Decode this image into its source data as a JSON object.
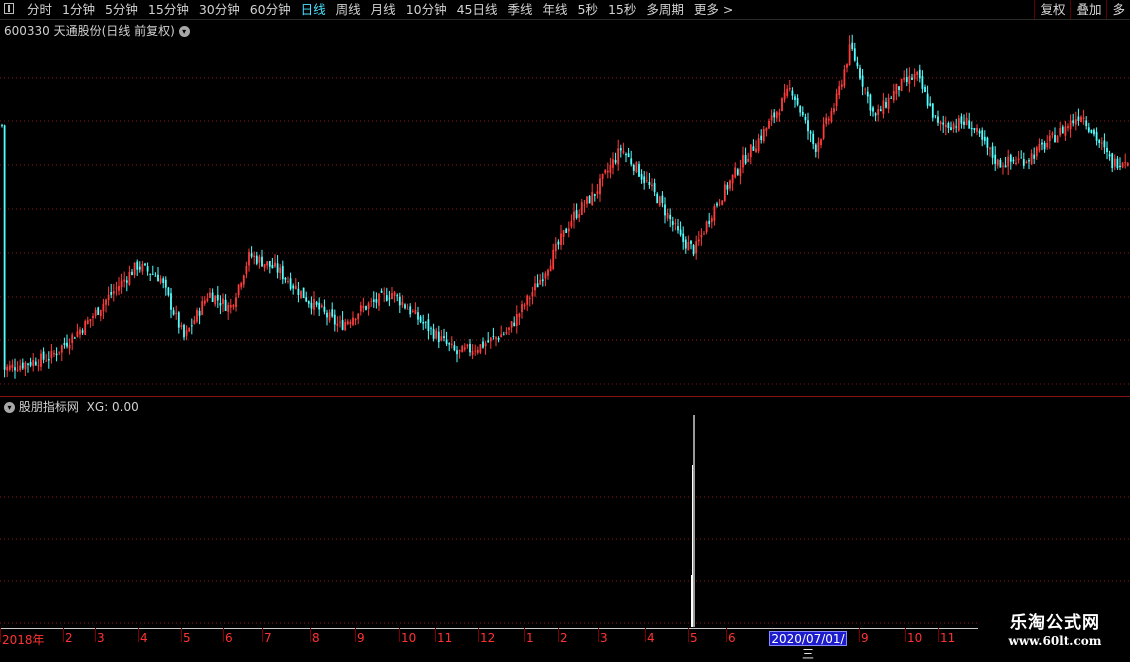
{
  "toolbar": {
    "periods": [
      "分时",
      "1分钟",
      "5分钟",
      "15分钟",
      "30分钟",
      "60分钟",
      "日线",
      "周线",
      "月线",
      "10分钟",
      "45日线",
      "季线",
      "年线",
      "5秒",
      "15秒",
      "多周期",
      "更多 >"
    ],
    "active_period": "日线",
    "right_buttons": [
      "复权",
      "叠加",
      "多"
    ]
  },
  "main_panel": {
    "title": "600330 天通股份(日线 前复权)"
  },
  "indicator_panel": {
    "title": "股朋指标网",
    "value_label": "XG: 0.00"
  },
  "x_axis": {
    "labels": [
      "2018年",
      "2",
      "3",
      "4",
      "5",
      "6",
      "7",
      "8",
      "9",
      "10",
      "11",
      "12",
      "1",
      "2",
      "3",
      "4",
      "5",
      "6",
      "9",
      "10",
      "11"
    ],
    "cursor_date": "2020/07/01/三"
  },
  "watermark": {
    "line1": "乐淘公式网",
    "line2": "www.60lt.com"
  },
  "colors": {
    "up": "#ff3c3c",
    "down": "#54ffff",
    "grid": "#8a1414",
    "signal": "#ffffff",
    "active_period": "#48e1ff",
    "axis_label": "#ff3232"
  },
  "chart_data": [
    {
      "type": "candlestick",
      "title": "600330 天通股份(日线 前复权)",
      "x_range": [
        "2018-01",
        "2020-11"
      ],
      "price_path": [
        [
          "2018-01-02",
          100
        ],
        [
          "2018-01-25",
          108
        ],
        [
          "2018-02-20",
          130
        ],
        [
          "2018-03-10",
          148
        ],
        [
          "2018-03-30",
          168
        ],
        [
          "2018-04-15",
          160
        ],
        [
          "2018-05-02",
          120
        ],
        [
          "2018-05-20",
          150
        ],
        [
          "2018-06-05",
          140
        ],
        [
          "2018-06-20",
          175
        ],
        [
          "2018-07-10",
          165
        ],
        [
          "2018-07-30",
          145
        ],
        [
          "2018-08-20",
          128
        ],
        [
          "2018-09-05",
          140
        ],
        [
          "2018-09-25",
          150
        ],
        [
          "2018-10-20",
          130
        ],
        [
          "2018-11-15",
          110
        ],
        [
          "2018-12-01",
          115
        ],
        [
          "2018-12-20",
          125
        ],
        [
          "2019-01-15",
          160
        ],
        [
          "2019-02-10",
          200
        ],
        [
          "2019-02-25",
          215
        ],
        [
          "2019-03-15",
          245
        ],
        [
          "2019-03-25",
          232
        ],
        [
          "2019-04-10",
          210
        ],
        [
          "2019-04-25",
          185
        ],
        [
          "2019-05-05",
          178
        ],
        [
          "2019-05-20",
          205
        ],
        [
          "2019-06-10",
          235
        ],
        [
          "2019-06-25",
          255
        ],
        [
          "2019-07-15",
          285
        ],
        [
          "2019-08-01",
          245
        ],
        [
          "2019-08-15",
          275
        ],
        [
          "2019-08-25",
          312
        ],
        [
          "2019-09-10",
          265
        ],
        [
          "2019-09-25",
          285
        ],
        [
          "2019-10-10",
          293
        ],
        [
          "2019-10-30",
          260
        ],
        [
          "2019-11-20",
          262
        ],
        [
          "2019-12-10",
          235
        ],
        [
          "2019-12-30",
          238
        ],
        [
          "2020-01-15",
          250
        ],
        [
          "2020-02-05",
          268
        ],
        [
          "2020-02-25",
          235
        ],
        [
          "2020-03-10",
          240
        ],
        [
          "2020-04-01",
          265
        ],
        [
          "2020-04-20",
          268
        ],
        [
          "2020-05-15",
          258
        ],
        [
          "2020-06-10",
          255
        ],
        [
          "2020-06-25",
          248
        ],
        [
          "2020-07-10",
          280
        ],
        [
          "2020-07-25",
          260
        ]
      ]
    },
    {
      "type": "bar",
      "title": "股朋指标网",
      "series": [
        {
          "name": "XG",
          "points": [
            [
              "2019-05-01",
              1
            ]
          ]
        }
      ],
      "current_value": 0.0
    }
  ]
}
